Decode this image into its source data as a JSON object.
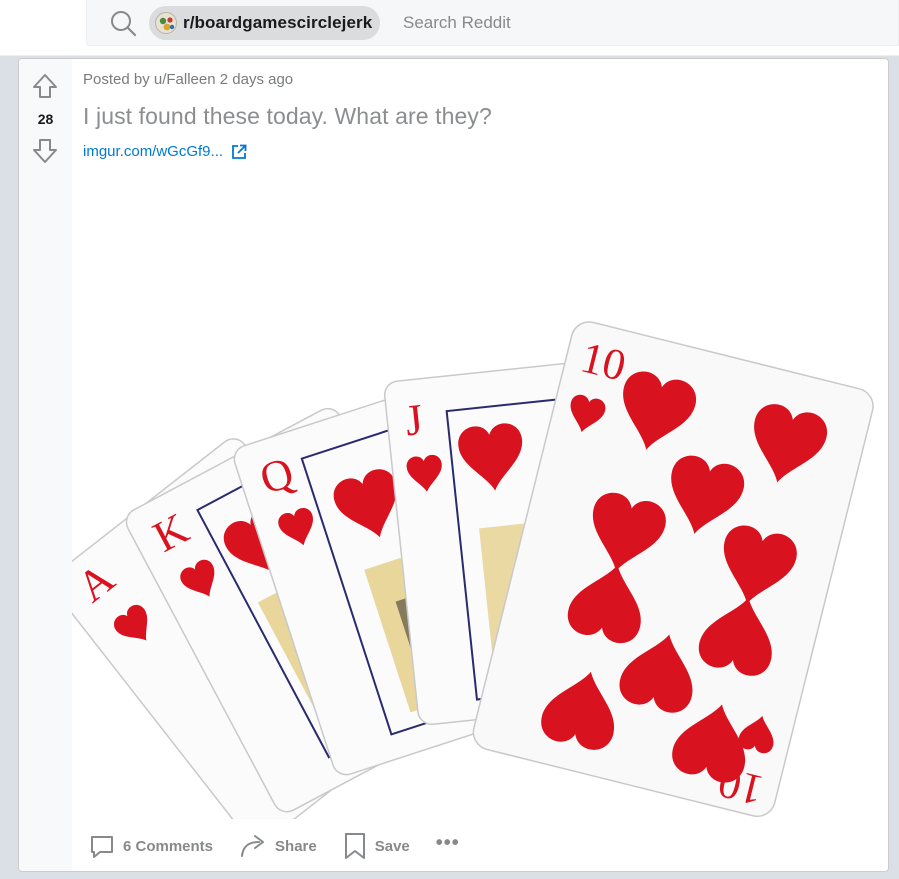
{
  "header": {
    "community": "r/boardgamescirclejerk",
    "search_placeholder": "Search Reddit"
  },
  "post": {
    "score": "28",
    "meta": "Posted by u/Falleen 2 days ago",
    "title": "I just found these today. What are they?",
    "link": "imgur.com/wGcGf9...",
    "image_alt": "Royal flush of hearts: A, K, Q, J, 10 playing cards fanned out",
    "cards": [
      {
        "rank": "A"
      },
      {
        "rank": "K"
      },
      {
        "rank": "Q"
      },
      {
        "rank": "J"
      },
      {
        "rank": "10"
      }
    ],
    "actions": {
      "comments": "6 Comments",
      "share": "Share",
      "save": "Save",
      "more": "•••"
    }
  },
  "colors": {
    "accent_link": "#0079d3",
    "card_red": "#d8131f",
    "muted_text": "#878a8c"
  }
}
